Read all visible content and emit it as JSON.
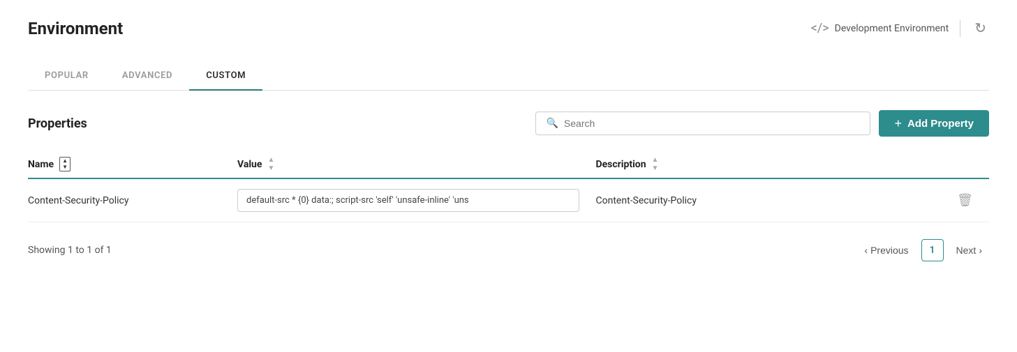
{
  "header": {
    "title": "Environment",
    "env_label": "Development Environment",
    "refresh_icon": "↺"
  },
  "tabs": [
    {
      "id": "popular",
      "label": "POPULAR",
      "active": false
    },
    {
      "id": "advanced",
      "label": "ADVANCED",
      "active": false
    },
    {
      "id": "custom",
      "label": "CUSTOM",
      "active": true
    }
  ],
  "section": {
    "title": "Properties",
    "search_placeholder": "Search",
    "add_button_label": "Add Property"
  },
  "table": {
    "columns": [
      {
        "label": "Name",
        "sortable": true
      },
      {
        "label": "Value",
        "sortable": true
      },
      {
        "label": "Description",
        "sortable": true
      }
    ],
    "rows": [
      {
        "name": "Content-Security-Policy",
        "value": "default-src * {0} data:; script-src 'self' 'unsafe-inline' 'uns",
        "description": "Content-Security-Policy"
      }
    ]
  },
  "pagination": {
    "showing_text": "Showing 1 to 1 of 1",
    "prev_label": "Previous",
    "next_label": "Next",
    "current_page": "1"
  }
}
